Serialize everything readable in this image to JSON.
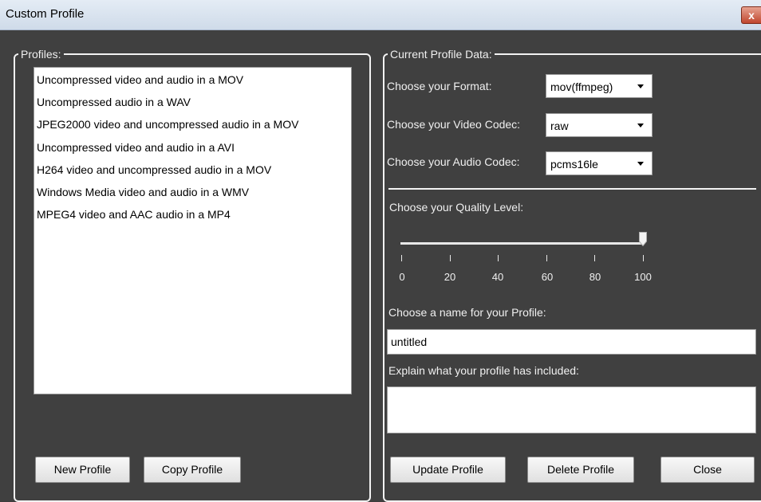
{
  "window": {
    "title": "Custom Profile",
    "close_glyph": "x"
  },
  "profiles": {
    "legend": "Profiles:",
    "items": [
      "Uncompressed video and audio in a MOV",
      "Uncompressed audio in a WAV",
      "JPEG2000 video and uncompressed audio in a MOV",
      "Uncompressed video and audio in a AVI",
      "H264 video and uncompressed audio in a MOV",
      "Windows Media video and audio in a WMV",
      "MPEG4 video and AAC audio in a MP4"
    ],
    "new_label": "New Profile",
    "copy_label": "Copy Profile"
  },
  "current": {
    "legend": "Current Profile Data:",
    "format_label": "Choose your Format:",
    "format_value": "mov(ffmpeg)",
    "video_label": "Choose your Video Codec:",
    "video_value": "raw",
    "audio_label": "Choose your Audio Codec:",
    "audio_value": "pcms16le",
    "quality_label": "Choose your Quality Level:",
    "quality_value": 100,
    "quality_ticks": [
      "0",
      "20",
      "40",
      "60",
      "80",
      "100"
    ],
    "name_label": "Choose a name for your Profile:",
    "name_value": "untitled",
    "explain_label": "Explain what your profile has included:",
    "explain_value": "",
    "update_label": "Update Profile",
    "delete_label": "Delete Profile",
    "close_label": "Close"
  },
  "icons": {
    "slider_thumb": "slider-thumb-icon",
    "dropdown_arrow": "chevron-down-icon",
    "window_close": "close-icon"
  }
}
